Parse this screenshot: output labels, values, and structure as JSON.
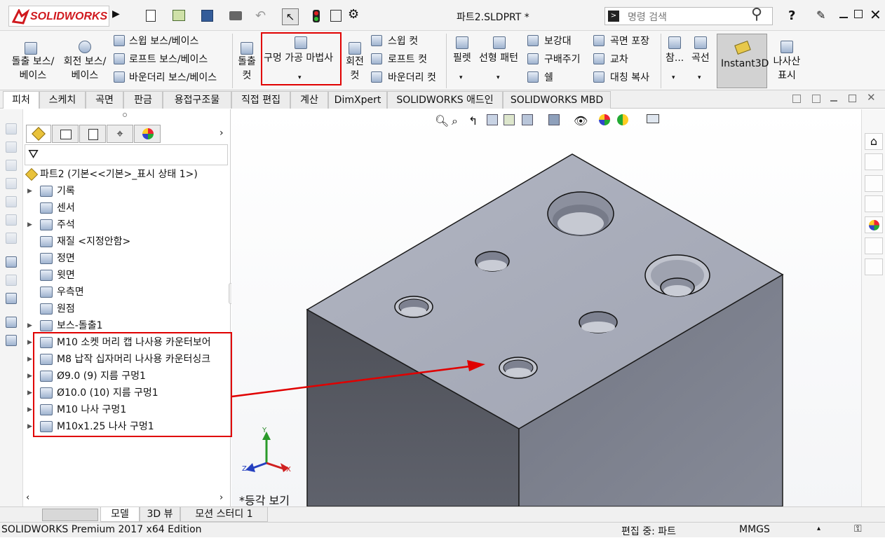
{
  "app": {
    "logo_text": "SOLIDWORKS",
    "doc_title": "파트2.SLDPRT *",
    "search_placeholder": "명령 검색",
    "help_icon": "?"
  },
  "ribbon": {
    "extrude_boss": "돌출 보스/베이스",
    "revolve_boss": "회전 보스/베이스",
    "sweep_boss": "스윕 보스/베이스",
    "loft_boss": "로프트 보스/베이스",
    "boundary_boss": "바운더리 보스/베이스",
    "extrude_cut": "돌출 컷",
    "hole_wizard": "구멍 가공 마법사",
    "revolve_cut": "회전 컷",
    "sweep_cut": "스윕 컷",
    "loft_cut": "로프트 컷",
    "boundary_cut": "바운더리 컷",
    "fillet": "필렛",
    "linear_pattern": "선형 패턴",
    "rib": "보강대",
    "draft": "구배주기",
    "shell": "쉘",
    "wrap": "곡면 포장",
    "intersect": "교차",
    "mirror": "대칭 복사",
    "reference": "참...",
    "curves": "곡선",
    "instant3d": "Instant3D",
    "cosmetic_thread": "나사산 표시"
  },
  "tabs": [
    "피처",
    "스케치",
    "곡면",
    "판금",
    "용접구조물",
    "직접 편집",
    "계산",
    "DimXpert",
    "SOLIDWORKS 애드인",
    "SOLIDWORKS MBD"
  ],
  "feature_tree": {
    "root": "파트2  (기본<<기본>_표시 상태 1>)",
    "items": [
      "기록",
      "센서",
      "주석",
      "재질 <지정안함>",
      "정면",
      "윗면",
      "우측면",
      "원점",
      "보스-돌출1"
    ],
    "hole_items": [
      "M10 소켓 머리 캡 나사용 카운터보어",
      "M8 납작 십자머리 나사용 카운터싱크",
      "Ø9.0 (9) 지름 구멍1",
      "Ø10.0 (10) 지름 구멍1",
      "M10 나사 구멍1",
      "M10x1.25 나사 구멍1"
    ]
  },
  "viewport": {
    "view_label": "*등각 보기",
    "axis_x": "X",
    "axis_y": "Y",
    "axis_z": "Z"
  },
  "bottom_tabs": [
    "모델",
    "3D 뷰",
    "모션 스터디 1"
  ],
  "status": {
    "edition": "SOLIDWORKS Premium 2017 x64 Edition",
    "edit_state": "편집 중: 파트",
    "units": "MMGS"
  },
  "colors": {
    "accent": "#e00000",
    "brand": "#d0191e",
    "part_top": "#a9adbb",
    "part_left": "#565963",
    "part_right": "#7c808d"
  }
}
